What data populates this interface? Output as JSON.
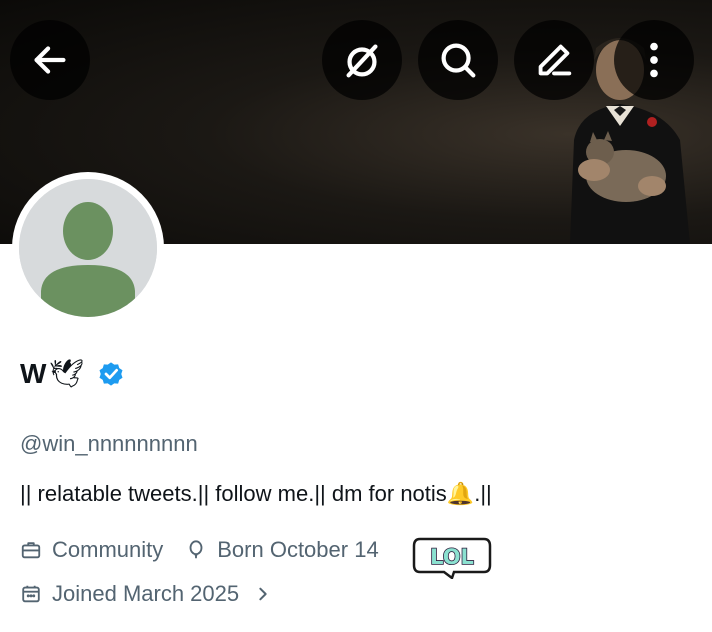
{
  "header": {
    "back_icon": "arrow-left-icon",
    "grok_icon": "slash-circle-icon",
    "search_icon": "search-icon",
    "edit_icon": "pen-icon",
    "more_icon": "more-vertical-icon"
  },
  "profile": {
    "display_name": "W",
    "name_emoji": "🕊",
    "verified": true,
    "verified_color": "#1d9bf0",
    "handle": "@win_nnnnnnnnn",
    "bio_text": "|| relatable tweets.|| follow me.|| dm for notis",
    "bio_emoji": "🔔",
    "bio_end": ".||",
    "category": "Community",
    "birthday": "Born October 14",
    "joined": "Joined March 2025"
  },
  "sticker": {
    "text": "LOL"
  },
  "colors": {
    "secondary_text": "#536471",
    "primary_text": "#0f1419",
    "avatar_bg": "#d7dadc",
    "avatar_figure": "#6b9160"
  }
}
